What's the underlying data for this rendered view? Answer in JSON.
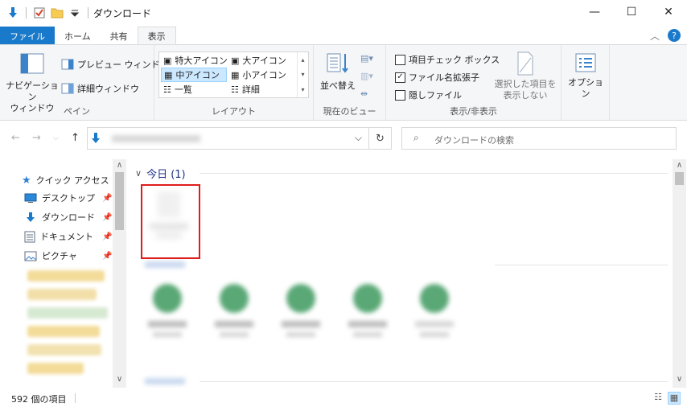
{
  "window": {
    "title": "ダウンロード",
    "minimize": "—",
    "maximize": "☐",
    "close": "✕"
  },
  "ribbon_tabs": [
    {
      "label": "ファイル"
    },
    {
      "label": "ホーム"
    },
    {
      "label": "共有"
    },
    {
      "label": "表示"
    }
  ],
  "ribbon": {
    "pane_group": {
      "label": "ペイン",
      "navigation_pane": "ナビゲーション\nウィンドウ",
      "preview_pane": "プレビュー ウィンドウ",
      "details_pane": "詳細ウィンドウ"
    },
    "layout_group": {
      "label": "レイアウト",
      "items": [
        "特大アイコン",
        "大アイコン",
        "中アイコン",
        "小アイコン",
        "一覧",
        "詳細"
      ],
      "selected": "中アイコン"
    },
    "current_view_group": {
      "label": "現在のビュー",
      "sort_by": "並べ替え"
    },
    "show_hide_group": {
      "label": "表示/非表示",
      "item_checkboxes": {
        "label": "項目チェック ボックス",
        "checked": false
      },
      "file_extensions": {
        "label": "ファイル名拡張子",
        "checked": true
      },
      "hidden_items": {
        "label": "隠しファイル",
        "checked": false
      },
      "hide_selected": "選択した項目を\n表示しない"
    },
    "options": "オプション"
  },
  "search": {
    "placeholder": "ダウンロードの検索"
  },
  "nav_pane": {
    "quick_access": "クイック アクセス",
    "items": [
      {
        "label": "デスクトップ",
        "pinned": true
      },
      {
        "label": "ダウンロード",
        "pinned": true
      },
      {
        "label": "ドキュメント",
        "pinned": true
      },
      {
        "label": "ピクチャ",
        "pinned": true
      }
    ]
  },
  "content": {
    "group_header": "今日 (1)"
  },
  "status": {
    "item_count": "592 個の項目"
  },
  "colors": {
    "accent": "#1979ca",
    "selection_outline": "#e01b1b",
    "group_header": "#1e3287"
  }
}
